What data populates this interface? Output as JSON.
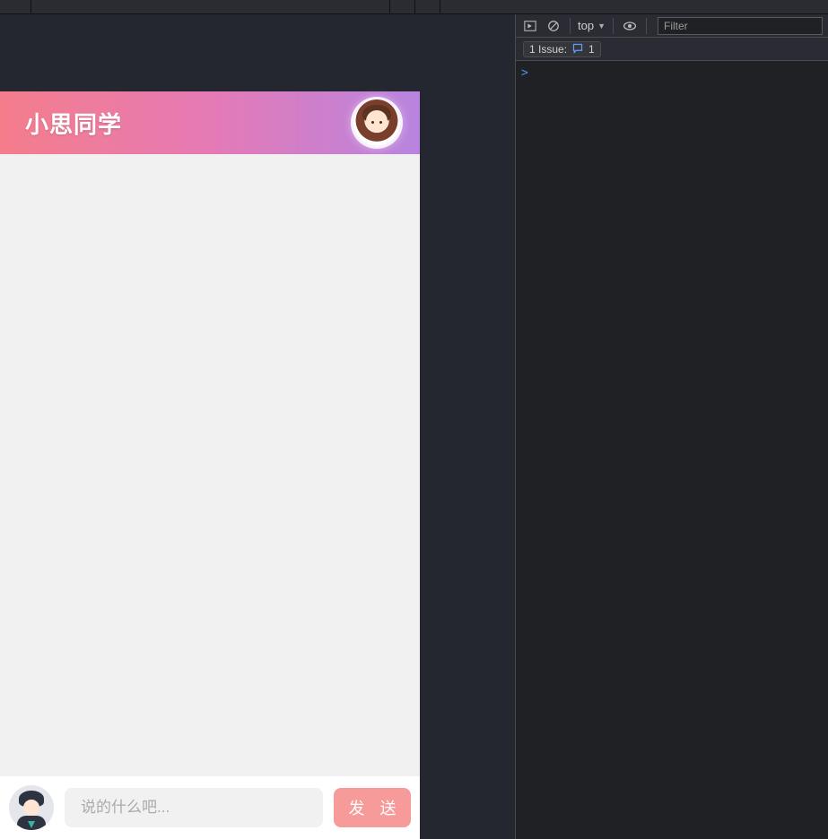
{
  "chat": {
    "title": "小思同学",
    "input_placeholder": "说的什么吧...",
    "send_label": "发 送"
  },
  "devtools": {
    "context_selector": "top",
    "filter_placeholder": "Filter",
    "issue_label": "1 Issue:",
    "issue_count": "1",
    "prompt_symbol": ">"
  },
  "colors": {
    "header_gradient_start": "#f47d8b",
    "header_gradient_end": "#b884e0",
    "send_button": "#f69a9a"
  }
}
